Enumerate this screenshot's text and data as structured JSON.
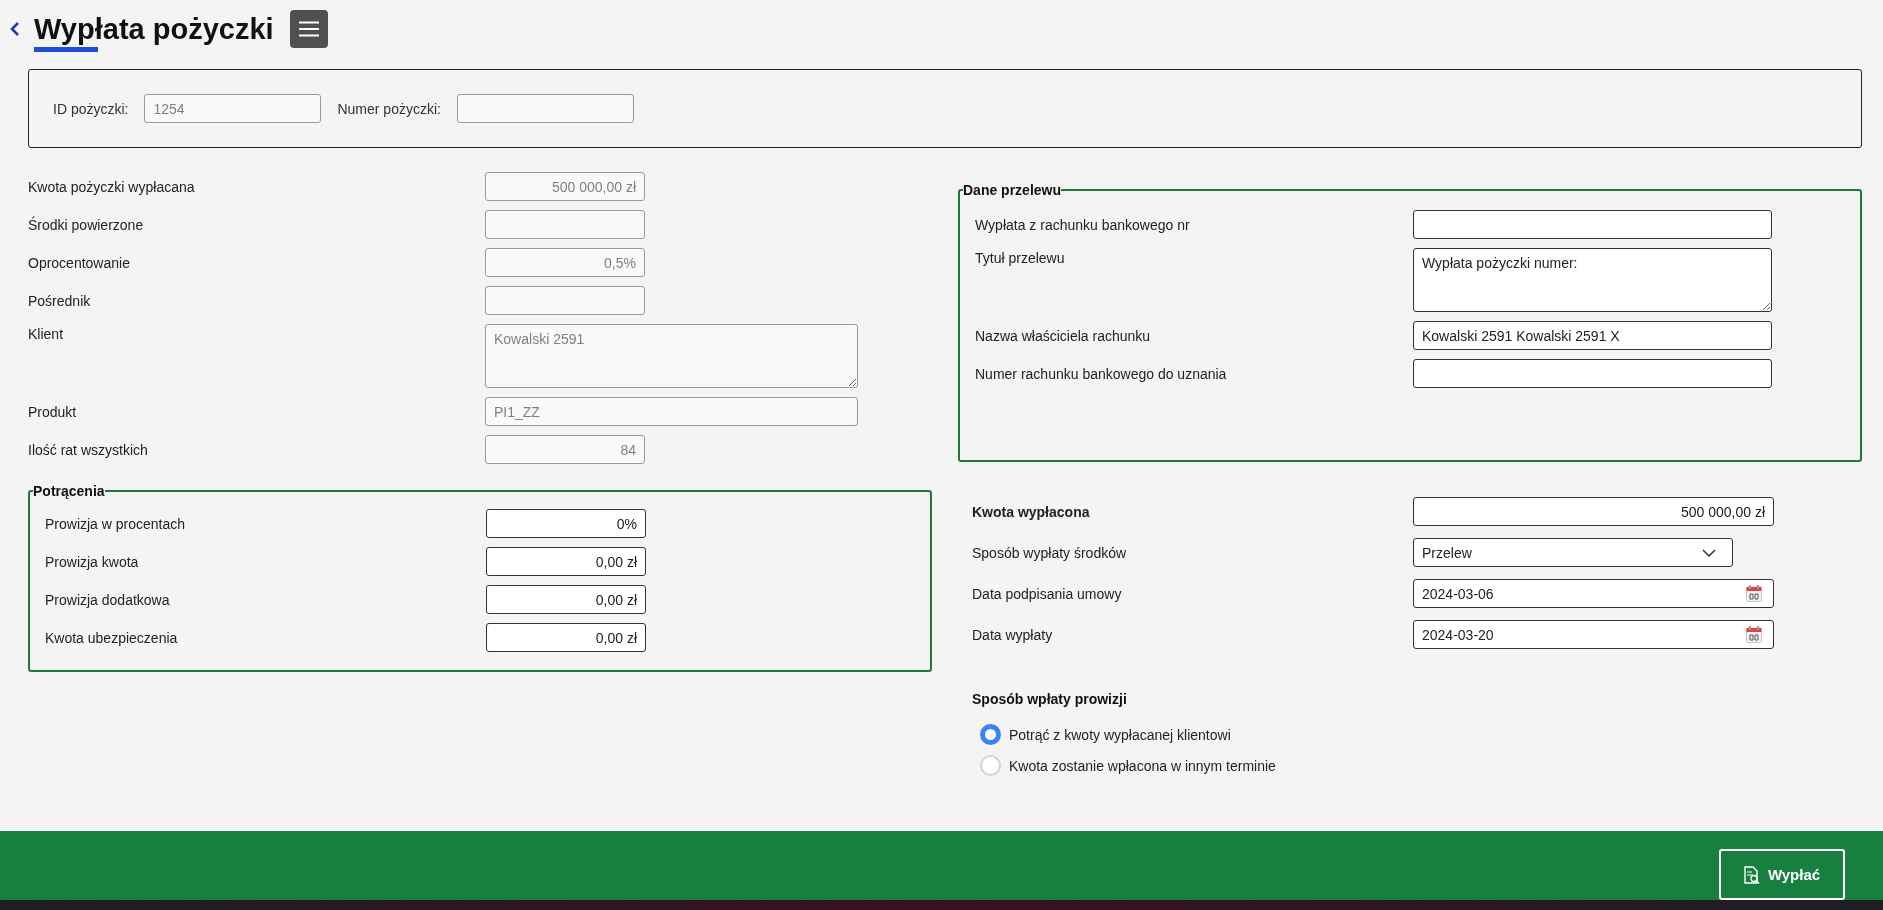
{
  "header": {
    "title": "Wypłata pożyczki"
  },
  "loan_bar": {
    "fields": [
      {
        "label": "ID pożyczki:",
        "value": "1254",
        "disabled": true
      },
      {
        "label": "Numer pożyczki:",
        "disabled": true
      }
    ]
  },
  "loan_details": {
    "fields": [
      {
        "label": "Kwota pożyczki wypłacana",
        "kind": "amount",
        "value": "500 000,00 zł",
        "disabled": true
      },
      {
        "label": "Środki powierzone",
        "kind": "amount",
        "disabled": true
      },
      {
        "label": "Oprocentowanie",
        "kind": "amount",
        "value": "0,5%",
        "disabled": true
      },
      {
        "label": "Pośrednik",
        "kind": "amount",
        "disabled": true
      },
      {
        "label": "Klient",
        "kind": "textarea",
        "value": "Kowalski 2591",
        "disabled": true
      },
      {
        "label": "Produkt",
        "kind": "text",
        "value": "PI1_ZZ",
        "disabled": true
      },
      {
        "label": "Ilość rat wszystkich",
        "kind": "amount",
        "value": "84",
        "disabled": true
      }
    ]
  },
  "deductions": {
    "legend": "Potrącenia",
    "fields": [
      {
        "label": "Prowizja w procentach",
        "kind": "amount",
        "value": "0%",
        "disabled": false
      },
      {
        "label": "Prowizja kwota",
        "kind": "amount",
        "value": "0,00 zł",
        "disabled": false
      },
      {
        "label": "Prowizja dodatkowa",
        "kind": "amount",
        "value": "0,00 zł",
        "disabled": false
      },
      {
        "label": "Kwota ubezpieczenia",
        "kind": "amount",
        "value": "0,00 zł",
        "disabled": false
      }
    ]
  },
  "transfer": {
    "legend": "Dane przelewu",
    "fields": [
      {
        "label": "Wypłata z rachunku bankowego nr",
        "kind": "text",
        "disabled": false
      },
      {
        "label": "Tytuł przelewu",
        "kind": "textarea",
        "value": "Wypłata pożyczki numer:",
        "disabled": false
      },
      {
        "label": "Nazwa właściciela rachunku",
        "kind": "text",
        "value": "Kowalski 2591 Kowalski 2591 X",
        "disabled": false
      },
      {
        "label": "Numer rachunku bankowego do uznania",
        "kind": "text",
        "disabled": false
      }
    ]
  },
  "payout": {
    "fields": [
      {
        "label": "Kwota wypłacona",
        "kind": "total",
        "value": "500 000,00 zł",
        "disabled": false
      },
      {
        "label": "Sposób wypłaty środków",
        "kind": "select",
        "value": "Przelew",
        "disabled": false
      },
      {
        "label": "Data podpisania umowy",
        "kind": "date",
        "value": "2024-03-06",
        "disabled": false
      },
      {
        "label": "Data wypłaty",
        "kind": "date",
        "value": "2024-03-20",
        "disabled": false
      }
    ]
  },
  "commission": {
    "title": "Sposób wpłaty prowizji",
    "options": [
      {
        "label": "Potrąć z kwoty wypłacanej klientowi",
        "selected": true
      },
      {
        "label": "Kwota zostanie wpłacona w innym terminie",
        "selected": false
      }
    ]
  },
  "footer": {
    "button": "Wypłać"
  }
}
